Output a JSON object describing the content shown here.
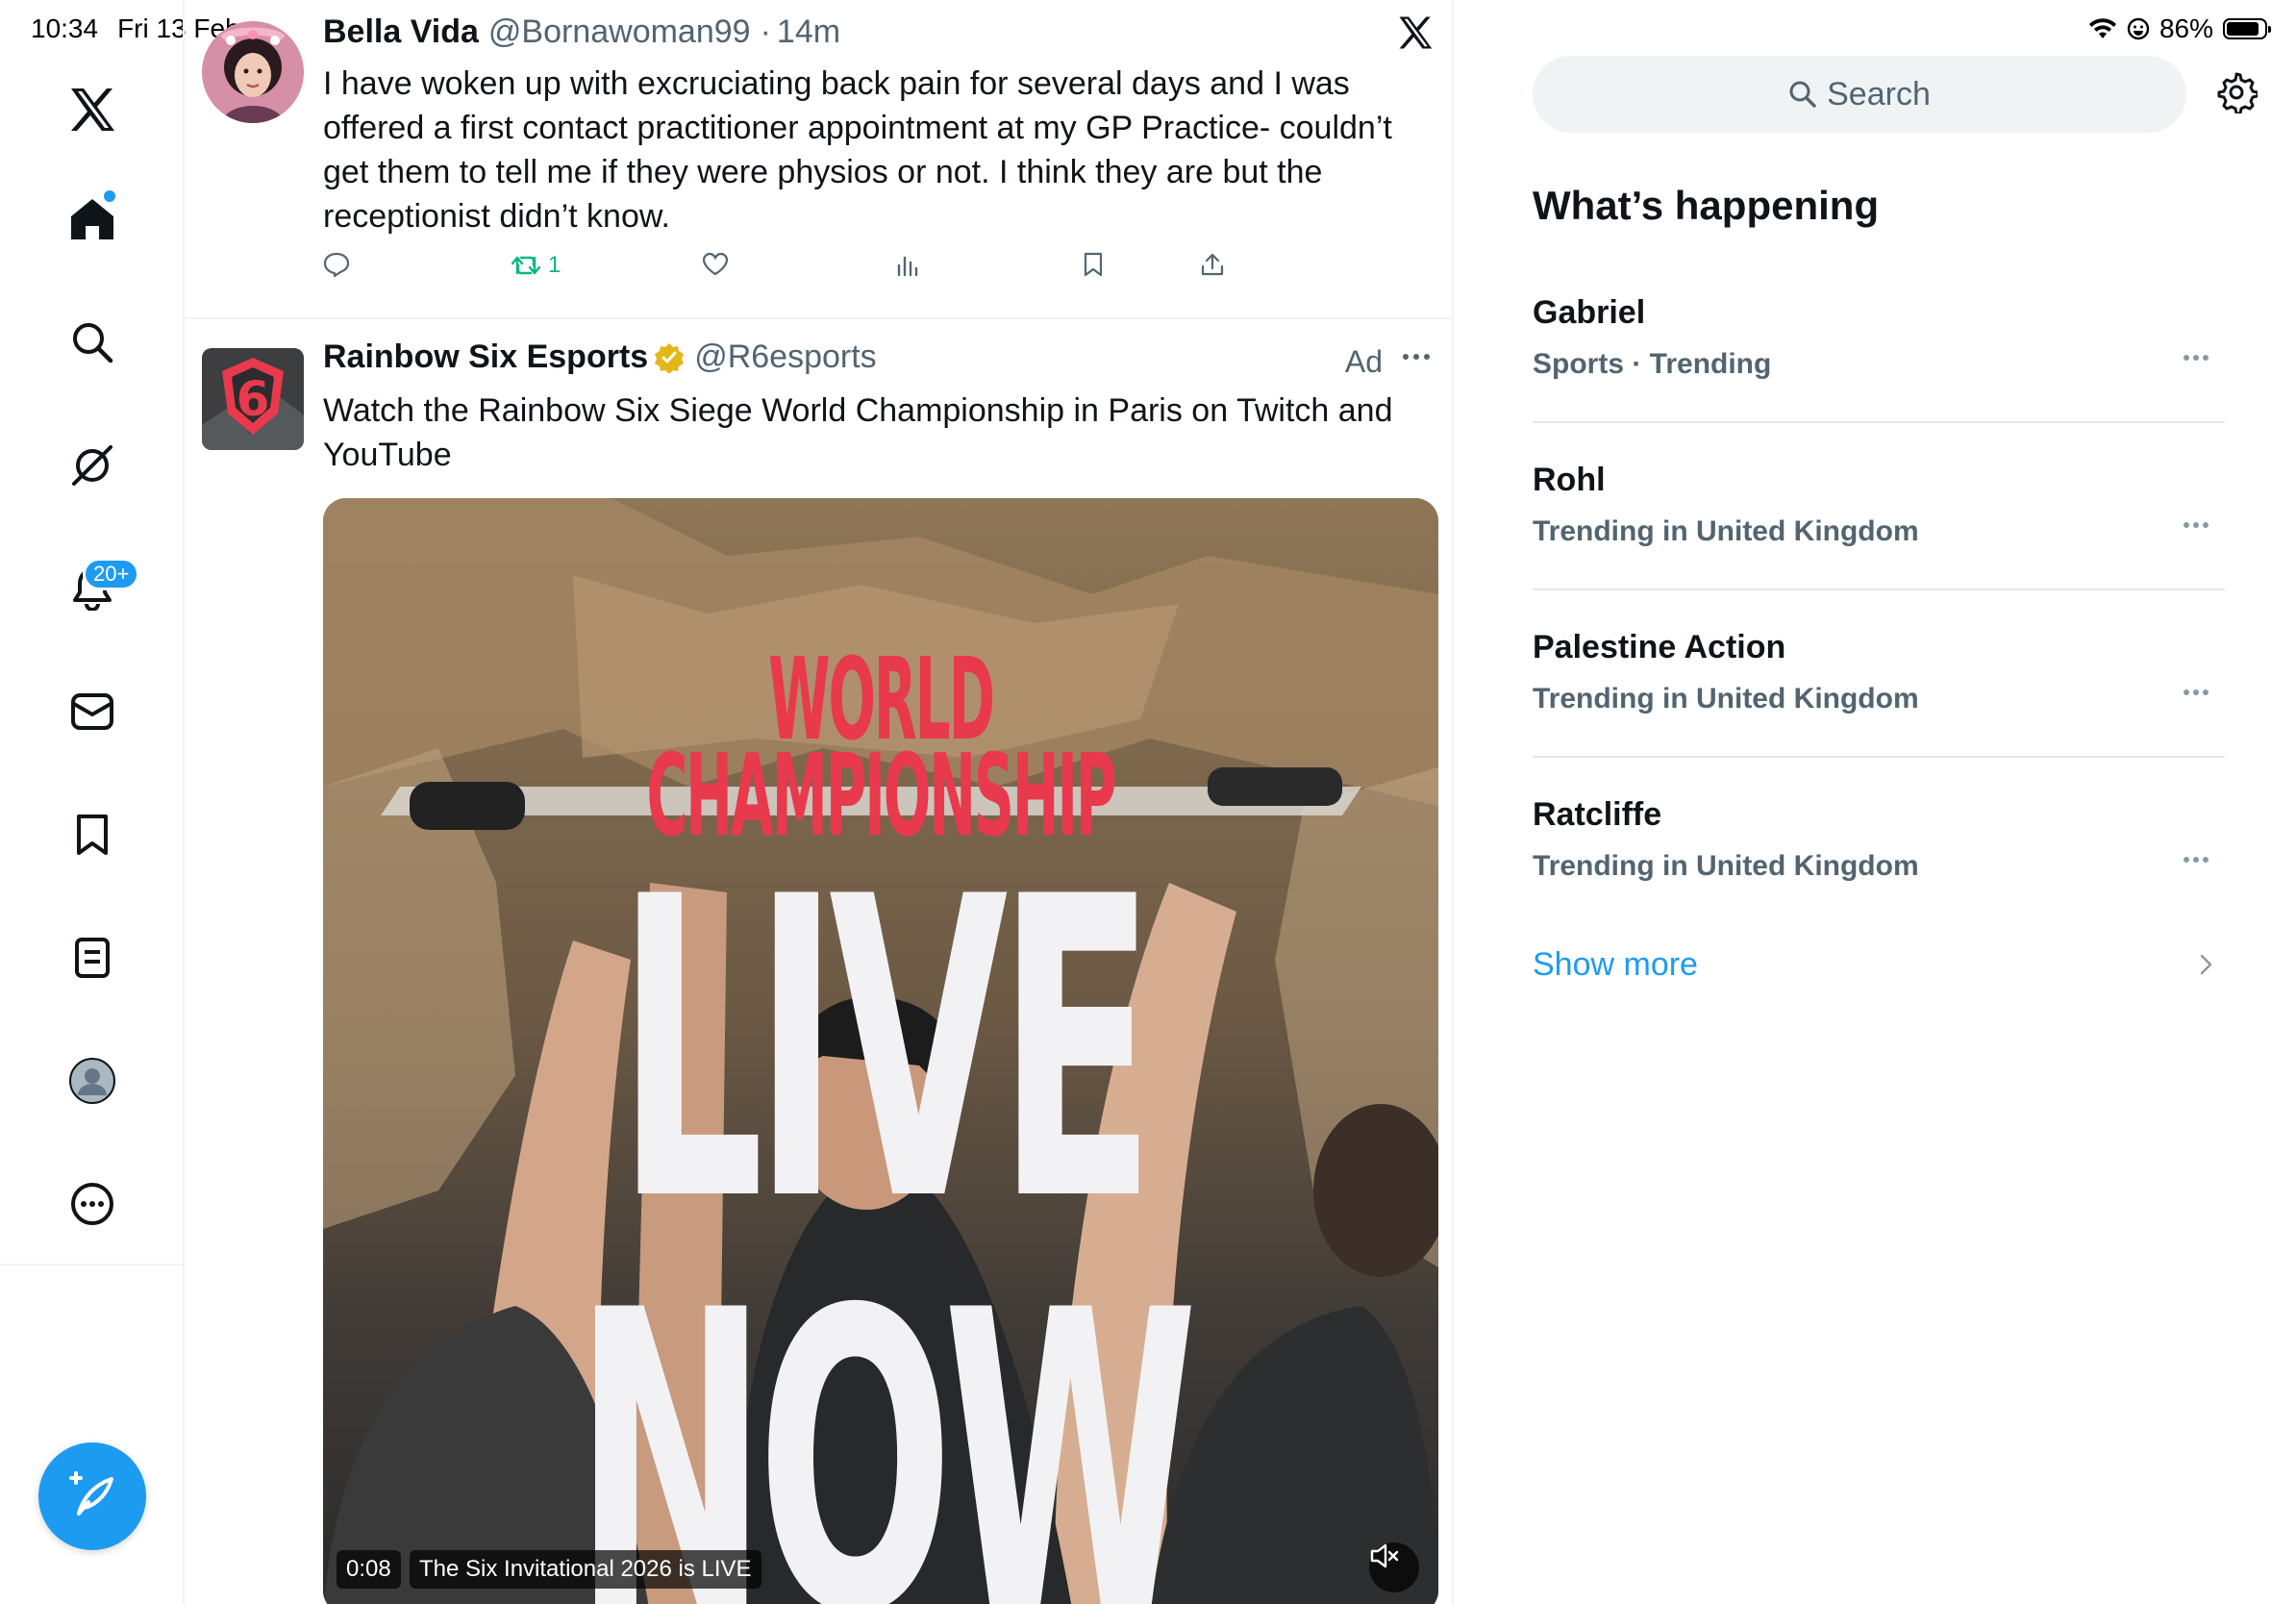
{
  "status": {
    "time": "10:34",
    "date": "Fri 13 Feb",
    "battery": "86%",
    "battery_level": 0.86
  },
  "nav": {
    "items": [
      {
        "name": "x-logo-icon"
      },
      {
        "name": "home-icon"
      },
      {
        "name": "search-icon"
      },
      {
        "name": "grok-icon"
      },
      {
        "name": "notifications-icon"
      },
      {
        "name": "messages-icon"
      },
      {
        "name": "bookmarks-icon"
      },
      {
        "name": "lists-icon"
      },
      {
        "name": "profile-icon"
      },
      {
        "name": "more-icon"
      }
    ],
    "notification_badge": "20+",
    "compose_icon": "compose-feather-icon"
  },
  "posts": [
    {
      "name": "Bella Vida",
      "handle": "@Bornawoman99",
      "time": "14m",
      "text": "I have woken up with excruciating back pain for several days and I was offered a first contact practitioner appointment at my GP Practice- couldn’t get them to tell me if they were physios or not. I think they are but the receptionist didn’t know.",
      "retweets": "1"
    },
    {
      "name": "Rainbow Six Esports",
      "handle": "@R6esports",
      "ad_label": "Ad",
      "text": "Watch the Rainbow Six Siege World Championship in Paris on Twitch and YouTube",
      "media": {
        "title_line1": "WORLD",
        "title_line2": "CHAMPIONSHIP",
        "headline": "LIVE NOW",
        "video_time": "0:08",
        "caption": "The Six Invitational 2026 is LIVE"
      }
    }
  ],
  "sidebar": {
    "search_placeholder": "Search",
    "section_title": "What’s happening",
    "trends": [
      {
        "name": "Gabriel",
        "meta": "Sports · Trending"
      },
      {
        "name": "Rohl",
        "meta": "Trending in United Kingdom"
      },
      {
        "name": "Palestine Action",
        "meta": "Trending in United Kingdom"
      },
      {
        "name": "Ratcliffe",
        "meta": "Trending in United Kingdom"
      }
    ],
    "show_more": "Show more"
  },
  "colors": {
    "accent": "#1d9bf0",
    "retweet": "#00ba7c",
    "secondary_text": "#536471",
    "verified_gold": "#e2b719",
    "championship_red": "#e8394d"
  }
}
